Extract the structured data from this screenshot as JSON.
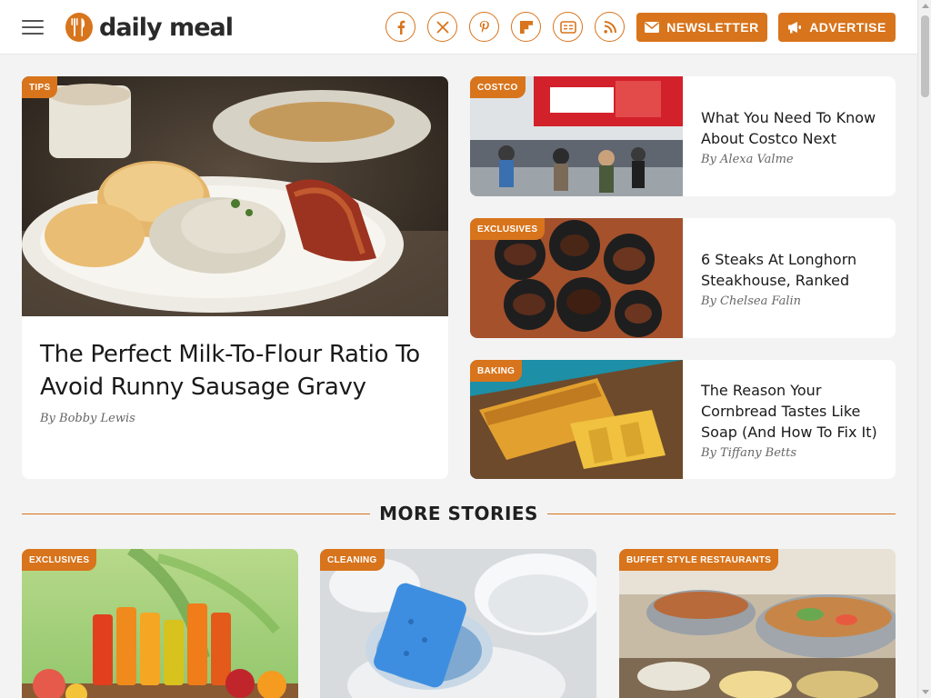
{
  "header": {
    "logo_text": "daily meal",
    "social": [
      {
        "name": "facebook"
      },
      {
        "name": "x-twitter"
      },
      {
        "name": "pinterest"
      },
      {
        "name": "flipboard"
      },
      {
        "name": "google-news"
      },
      {
        "name": "rss"
      }
    ],
    "newsletter_label": "NEWSLETTER",
    "advertise_label": "ADVERTISE"
  },
  "colors": {
    "accent": "#d8741c",
    "background": "#f3f3f3",
    "card": "#ffffff"
  },
  "featured": {
    "tag": "TIPS",
    "title": "The Perfect Milk-To-Flour Ratio To Avoid Runny Sausage Gravy",
    "author": "By Bobby Lewis"
  },
  "side_articles": [
    {
      "tag": "COSTCO",
      "title": "What You Need To Know About Costco Next",
      "author": "By Alexa Valme"
    },
    {
      "tag": "EXCLUSIVES",
      "title": "6 Steaks At Longhorn Steakhouse, Ranked",
      "author": "By Chelsea Falin"
    },
    {
      "tag": "BAKING",
      "title": "The Reason Your Cornbread Tastes Like Soap (And How To Fix It)",
      "author": "By Tiffany Betts"
    }
  ],
  "more_stories": {
    "heading": "MORE STORIES",
    "items": [
      {
        "tag": "EXCLUSIVES"
      },
      {
        "tag": "CLEANING"
      },
      {
        "tag": "BUFFET STYLE RESTAURANTS"
      }
    ]
  }
}
